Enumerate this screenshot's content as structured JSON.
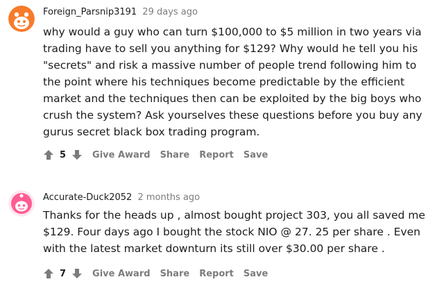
{
  "comments": [
    {
      "author": "Foreign_Parsnip3191",
      "time": "29 days ago",
      "lines": [
        "why would a guy who can turn $100,000 to $5 million in two years via",
        "trading have to sell you anything for $129? Why would he tell you his",
        "\"secrets\" and risk a massive number of people trend following him to",
        "the point where his techniques become predictable by the efficient",
        "market and the techniques then can be exploited by the big boys who",
        "crush the system? Ask yourselves these questions before you buy any",
        "gurus secret black box trading program."
      ],
      "score": "5",
      "actions": [
        "Give Award",
        "Share",
        "Report",
        "Save"
      ],
      "avatar_icon": "orange-snoo-avatar-icon",
      "avatar_color": "#f77b2a"
    },
    {
      "author": "Accurate-Duck2052",
      "time": "2 months ago",
      "lines": [
        "Thanks for the heads up , almost bought project 303, you all saved me",
        "$129. Four days ago I bought the stock NIO @ 27. 25 per share . Even",
        "with the latest market downturn its still over $30.00 per share ."
      ],
      "score": "7",
      "actions": [
        "Give Award",
        "Share",
        "Report",
        "Save"
      ],
      "avatar_icon": "pink-snoo-avatar-icon",
      "avatar_color": "#ff5c93"
    }
  ]
}
